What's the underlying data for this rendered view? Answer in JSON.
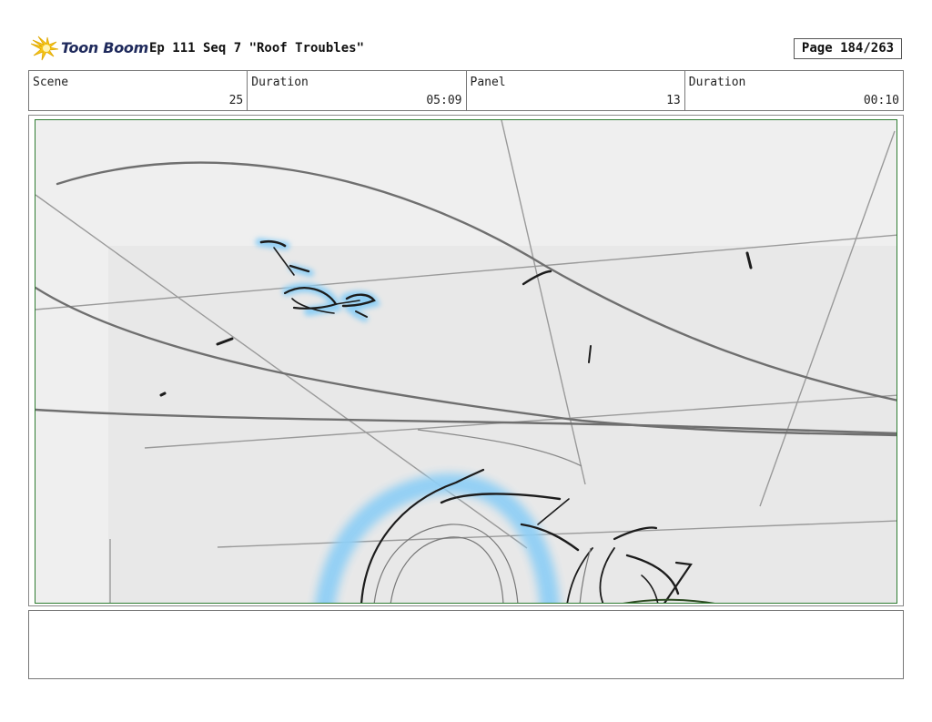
{
  "header": {
    "logo_text": "Toon Boom",
    "title": "Ep 111 Seq 7 \"Roof Troubles\"",
    "page": "Page 184/263"
  },
  "info": {
    "scene_label": "Scene",
    "scene_value": "25",
    "scene_duration_label": "Duration",
    "scene_duration_value": "05:09",
    "panel_label": "Panel",
    "panel_value": "13",
    "panel_duration_label": "Duration",
    "panel_duration_value": "00:10"
  },
  "colors": {
    "logo_yellow": "#f5c518",
    "logo_navy": "#1f2a5c",
    "frame_green": "#2f7d32",
    "highlight_blue": "#8fcff5"
  },
  "icons": {
    "logo": "toon-boom-logo-icon"
  }
}
